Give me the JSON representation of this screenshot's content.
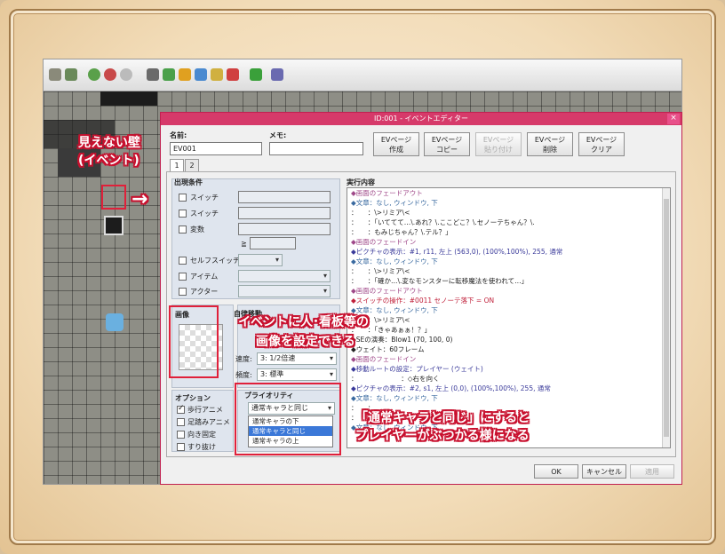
{
  "dialog": {
    "title": "ID:001 - イベントエディター",
    "close": "×",
    "name_label": "名前:",
    "name_value": "EV001",
    "memo_label": "メモ:",
    "memo_value": "",
    "buttons": [
      {
        "l1": "EVページ",
        "l2": "作成"
      },
      {
        "l1": "EVページ",
        "l2": "コピー"
      },
      {
        "l1": "EVページ",
        "l2": "貼り付け"
      },
      {
        "l1": "EVページ",
        "l2": "削除"
      },
      {
        "l1": "EVページ",
        "l2": "クリア"
      }
    ],
    "tabs": [
      "1",
      "2"
    ],
    "conditions": {
      "title": "出現条件",
      "switch1": "スイッチ",
      "switch2": "スイッチ",
      "variable": "変数",
      "ge": "≧",
      "self_switch": "セルフスイッチ",
      "item": "アイテム",
      "actor": "アクター"
    },
    "image": {
      "title": "画像"
    },
    "autonomous": {
      "title": "自律移動",
      "speed_label": "速度:",
      "speed_value": "3: 1/2倍速",
      "freq_label": "頻度:",
      "freq_value": "3: 標準"
    },
    "options": {
      "title": "オプション",
      "walk": "歩行アニメ",
      "step": "足踏みアニメ",
      "fix": "向き固定",
      "through": "すり抜け"
    },
    "priority": {
      "title": "プライオリティ",
      "value": "通常キャラと同じ",
      "options": [
        "通常キャラの下",
        "通常キャラと同じ",
        "通常キャラの上"
      ]
    },
    "contents": {
      "title": "実行内容",
      "lines": [
        "◆画面のフェードアウト",
        "◆文章：なし, ウィンドウ, 下",
        "：　　：\\>リミア\\<",
        "：　　：「いててて…\\.あれ？\\.ここどこ？\\.セノーテちゃん？\\.",
        "：　　：もみじちゃん？\\.テル？」",
        "◆画面のフェードイン",
        "◆ピクチャの表示：#1, r11, 左上 (563,0), (100%,100%), 255, 通常",
        "◆文章：なし, ウィンドウ, 下",
        "：　　：\\>リミア\\<",
        "：　　：「確か…\\.変なモンスターに転移魔法を使われて…」",
        "◆画面のフェードアウト",
        "◆スイッチの操作：#0011 セノーテ落下 = ON",
        "◆文章：なし, ウィンドウ, 下",
        "：　　：\\>リミア\\<",
        "：　　：「きゃあぁぁ！？」",
        "◆SEの演奏：Blow1 (70, 100, 0)",
        "◆ウェイト：60フレーム",
        "◆画面のフェードイン",
        "◆移動ルートの設定：プレイヤー (ウェイト)",
        "：　　　　　　　：◇右を向く",
        "◆ピクチャの表示：#2, s1, 左上 (0,0), (100%,100%), 255, 通常",
        "◆文章：なし, ウィンドウ, 下",
        "：　　：",
        "：　　：",
        "◆文章：なし, ウィンドウ, 下"
      ]
    },
    "ok": "OK",
    "cancel": "キャンセル",
    "apply": "適用"
  },
  "annotations": {
    "wall_line1": "見えない壁",
    "wall_line2": "(イベント)",
    "arrow": "→",
    "image_line1": "イベントに人･看板等の",
    "image_line2": "画像を設定できる",
    "priority_line1": "「通常キャラと同じ」にすると",
    "priority_line2": "プレイヤーがぶつかる様になる"
  },
  "colors": {
    "accent_red": "#e0203a",
    "titlebar": "#d63a6a"
  }
}
